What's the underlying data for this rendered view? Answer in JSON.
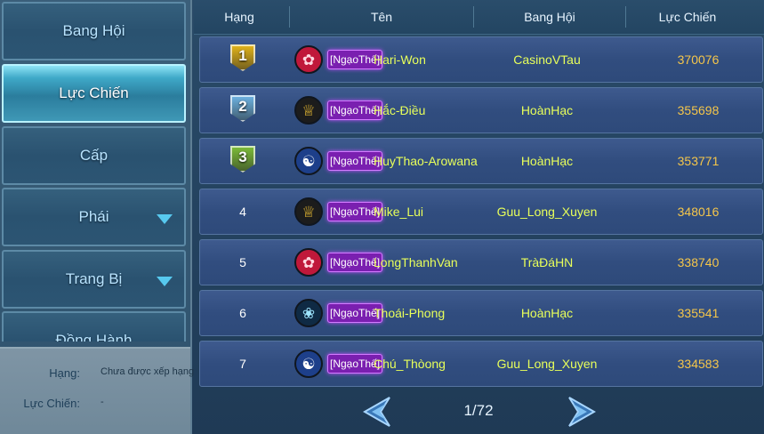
{
  "sidebar": {
    "menu": [
      {
        "label": "Bang Hội",
        "active": false,
        "dropdown": false
      },
      {
        "label": "Lực Chiến",
        "active": true,
        "dropdown": false
      },
      {
        "label": "Cấp",
        "active": false,
        "dropdown": false
      },
      {
        "label": "Phái",
        "active": false,
        "dropdown": true
      },
      {
        "label": "Trang Bị",
        "active": false,
        "dropdown": true
      },
      {
        "label": "Đồng Hành",
        "active": false,
        "dropdown": false
      }
    ],
    "info": {
      "rank_label": "Hạng:",
      "rank_value": "Chưa được xếp hạng",
      "power_label": "Lực Chiến:",
      "power_value": "-"
    }
  },
  "table": {
    "headers": {
      "rank": "Hạng",
      "name": "Tên",
      "guild": "Bang Hội",
      "power": "Lực Chiến"
    },
    "rows": [
      {
        "rank": "1",
        "medal": "gold",
        "emblem": "flower-emblem-icon",
        "tag": "[NgạoThế]",
        "name": "Hari-Won",
        "guild": "CasinoVTau",
        "power": "370076"
      },
      {
        "rank": "2",
        "medal": "silver",
        "emblem": "yellow-crest-emblem-icon",
        "tag": "[NgạoThế]",
        "name": "Hắc-Điều",
        "guild": "HoànHạc",
        "power": "355698"
      },
      {
        "rank": "3",
        "medal": "bronze",
        "emblem": "yin-yang-emblem-icon",
        "tag": "[NgạoThế]",
        "name": "HuyThao-Arowana",
        "guild": "HoànHạc",
        "power": "353771"
      },
      {
        "rank": "4",
        "medal": "",
        "emblem": "yellow-crest-emblem-icon",
        "tag": "[NgạoThế]",
        "name": "Mike_Lui",
        "guild": "Guu_Long_Xuyen",
        "power": "348016"
      },
      {
        "rank": "5",
        "medal": "",
        "emblem": "flower-emblem-icon",
        "tag": "[NgạoThế]",
        "name": "LongThanhVan",
        "guild": "TràĐáHN",
        "power": "338740"
      },
      {
        "rank": "6",
        "medal": "",
        "emblem": "fan-emblem-icon",
        "tag": "[NgạoThế]",
        "name": "Thoái-Phong",
        "guild": "HoànHạc",
        "power": "335541"
      },
      {
        "rank": "7",
        "medal": "",
        "emblem": "yin-yang-emblem-icon",
        "tag": "[NgạoThế]",
        "name": "Chú_Thòong",
        "guild": "Guu_Long_Xuyen",
        "power": "334583"
      }
    ]
  },
  "pager": {
    "text": "1/72"
  },
  "colors": {
    "gold": "#e8b81a",
    "silver": "#6fb6e6",
    "bronze": "#7fc03a",
    "name": "#e8ff5a",
    "power": "#f5c64a",
    "tag_bg": "#7a1fb0"
  }
}
